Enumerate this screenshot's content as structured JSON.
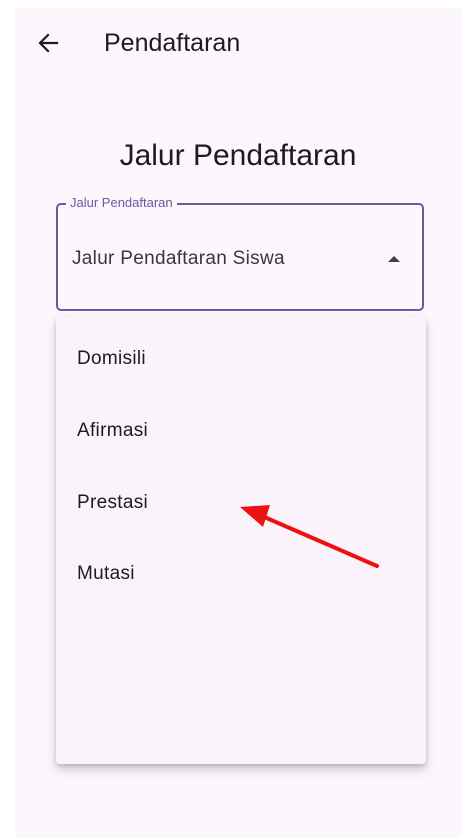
{
  "appbar": {
    "title": "Pendaftaran",
    "back_icon": "arrow-left-icon"
  },
  "section_title": "Jalur Pendaftaran",
  "dropdown": {
    "label": "Jalur Pendaftaran",
    "value": "Jalur Pendaftaran Siswa",
    "expanded": true,
    "caret_icon": "caret-up-icon",
    "accent_color": "#6f55a4"
  },
  "menu": {
    "items": [
      {
        "label": "Domisili"
      },
      {
        "label": "Afirmasi"
      },
      {
        "label": "Prestasi"
      },
      {
        "label": "Mutasi"
      }
    ]
  },
  "annotation": {
    "type": "arrow",
    "color": "#ee1111",
    "points_to": "Prestasi"
  }
}
